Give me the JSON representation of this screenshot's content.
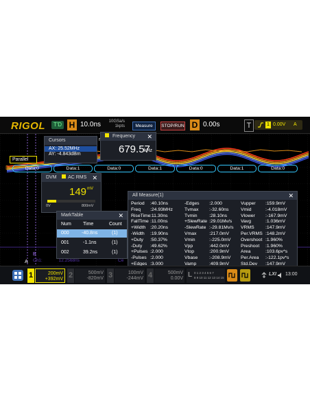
{
  "header": {
    "logo": "RIGOL",
    "mode_badge": "T'D",
    "h_label": "H",
    "timebase": "10.0ns",
    "sample_rate": "10GSa/s",
    "memory_depth": "1kpts",
    "measure_button": "Measure",
    "stoprun_button": "STOP/RUN",
    "d_label": "D",
    "delay": "0.00s",
    "t_label": "T",
    "trigger_level": "0.00V",
    "trigger_source": "A"
  },
  "waveform": {
    "parallel_label": "Parallel",
    "center_label": "nter",
    "bus_cells": [
      "Data:0",
      "Data:1",
      "Data:0",
      "Data:1",
      "Data:0",
      "Data:1",
      "Data:0"
    ],
    "cursor_labels": [
      "A",
      "B"
    ],
    "d_marker": "D",
    "d1_marker": "1"
  },
  "cursors": {
    "title": "Cursors",
    "ax": "AX: 25.52MHz",
    "ay": "AY: -4.843dBm"
  },
  "frequency": {
    "title": "Frequency",
    "value": "679.57",
    "unit": "kHz"
  },
  "dvm": {
    "title": "DVM",
    "mode": "AC RMS",
    "value": "149",
    "unit": "mV",
    "scale_min": "0V",
    "scale_max": "800mV",
    "level_fraction": 0.186
  },
  "marktable": {
    "title": "MarkTable",
    "headers": [
      "Num",
      "Time",
      "Count"
    ],
    "rows": [
      {
        "num": "000",
        "time": "-40.8ns",
        "count": "(1)"
      },
      {
        "num": "001",
        "time": "-1.1ns",
        "count": "(1)"
      },
      {
        "num": "002",
        "time": "39.2ns",
        "count": "(1)"
      }
    ]
  },
  "all_measure": {
    "title": "All Measure(1)",
    "columns": [
      [
        "Period",
        "Freq",
        "RiseTime",
        "FallTime",
        "+Width",
        "-Width",
        "+Duty",
        "-Duty",
        "+Pulses",
        "-Pulses",
        "+Edges"
      ],
      [
        ":40.10ns",
        ":24.93MHz",
        ":11.30ns",
        ":11.00ns",
        ":20.20ns",
        ":19.90ns",
        ":50.37%",
        ":49.62%",
        ":2.000",
        ":2.000",
        ":3.000"
      ],
      [
        "-Edges",
        "Tvmax",
        "Tvmin",
        "+SlewRate",
        "-SlewRate",
        "Vmax",
        "Vmin",
        "Vpp",
        "Vtop",
        "Vbase",
        "Vamp"
      ],
      [
        ":2.000",
        ":-32.60ns",
        ":28.10ns",
        ":29.01Mv/s",
        ":-29.81Mv/s",
        ":217.0mV",
        ":-225.0mV",
        ":442.0mV",
        ":200.9mV",
        ":-208.9mV",
        ":409.9mV"
      ],
      [
        "Vupper",
        "Vmid",
        "Vlower",
        "Vavg",
        "VRMS",
        "Per.VRMS",
        "Overshoot",
        "Preshoot",
        "Area",
        "Per.Area",
        "Std.Dev"
      ],
      [
        ":159.9mV",
        ":-4.018mV",
        ":-167.9mV",
        ":1.036mV",
        ":147.9mV",
        ":148.2mV",
        ":1.960%",
        ":1.960%",
        ":103.6pv*s",
        ":-122.1pv*s",
        ":147.9mV"
      ]
    ]
  },
  "status_row": {
    "ch1_freq": "Ch1:",
    "ch1_value": "12.2568ns",
    "right_label": "Ce"
  },
  "channels": [
    {
      "num": "1",
      "scale": "200mV",
      "offset": "+392mV",
      "active": true,
      "color": "#f2e400"
    },
    {
      "num": "2",
      "scale": "500mV",
      "offset": "-820mV",
      "active": false,
      "color": "#888888"
    },
    {
      "num": "3",
      "scale": "100mV",
      "offset": "-244mV",
      "active": false,
      "color": "#888888"
    },
    {
      "num": "4",
      "scale": "500mV",
      "offset": "0.00V",
      "active": false,
      "color": "#888888"
    }
  ],
  "logic": {
    "label": "L",
    "bits_top": "0 1 2 3 4 5 6 7",
    "bits_bottom": "8 9 10 11 12 13 14 15"
  },
  "footer": {
    "lxi": "LXI",
    "time": "13:00"
  },
  "colors": {
    "ch1": "#f2e400",
    "accent": "#3d6fb5",
    "bus": "#35c9ff",
    "orange": "#d98a18"
  }
}
